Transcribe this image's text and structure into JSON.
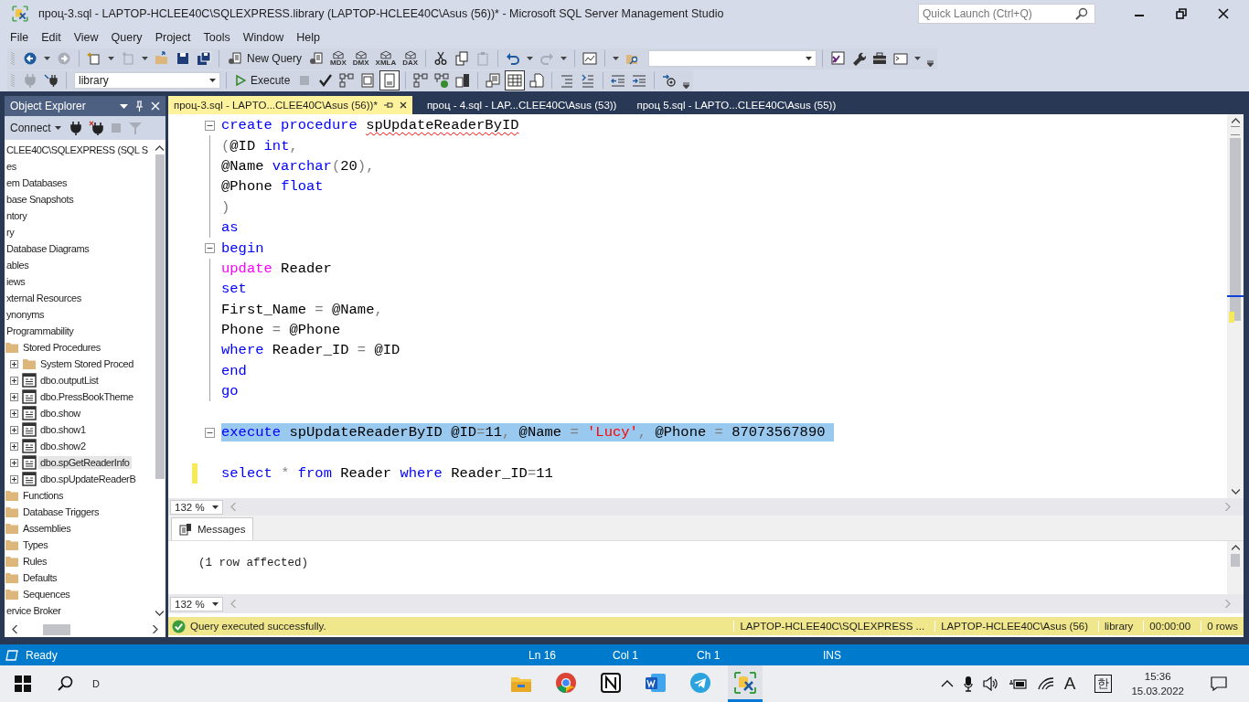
{
  "window": {
    "title": "проц-3.sql - LAPTOP-HCLEE40C\\SQLEXPRESS.library (LAPTOP-HCLEE40C\\Asus (56))* - Microsoft SQL Server Management Studio",
    "quick_launch": {
      "placeholder": "Quick Launch (Ctrl+Q)"
    }
  },
  "menu": [
    "File",
    "Edit",
    "View",
    "Query",
    "Project",
    "Tools",
    "Window",
    "Help"
  ],
  "toolbar": {
    "new_query": "New Query",
    "query_types": [
      "MDX",
      "DMX",
      "XMLA",
      "DAX"
    ],
    "database": "library",
    "execute": "Execute"
  },
  "object_explorer": {
    "title": "Object Explorer",
    "connect": "Connect",
    "tree": [
      {
        "label": "CLEE40C\\SQLEXPRESS (SQL S",
        "children": [
          {
            "label": "es",
            "children": [
              {
                "label": "em Databases"
              },
              {
                "label": "base Snapshots"
              },
              {
                "label": "ntory"
              },
              {
                "label": "ry",
                "children": [
                  {
                    "label": "Database Diagrams"
                  },
                  {
                    "label": "ables"
                  },
                  {
                    "label": "iews"
                  },
                  {
                    "label": "xternal Resources"
                  },
                  {
                    "label": "ynonyms"
                  },
                  {
                    "label": "Programmability",
                    "children": [
                      {
                        "label": "Stored Procedures",
                        "kind": "folder",
                        "children": [
                          {
                            "label": "System Stored Proced",
                            "kind": "folder",
                            "expanded": false,
                            "selected": false
                          },
                          {
                            "label": "dbo.outputList",
                            "kind": "procedure",
                            "expanded": false,
                            "selected": false
                          },
                          {
                            "label": "dbo.PressBookTheme",
                            "kind": "procedure",
                            "expanded": false,
                            "selected": false
                          },
                          {
                            "label": "dbo.show",
                            "kind": "procedure",
                            "expanded": false,
                            "selected": false
                          },
                          {
                            "label": "dbo.show1",
                            "kind": "procedure",
                            "expanded": false,
                            "selected": false
                          },
                          {
                            "label": "dbo.show2",
                            "kind": "procedure",
                            "expanded": false,
                            "selected": false
                          },
                          {
                            "label": "dbo.spGetReaderInfo",
                            "kind": "procedure",
                            "expanded": false,
                            "selected": true
                          },
                          {
                            "label": "dbo.spUpdateReaderB",
                            "kind": "procedure",
                            "expanded": false,
                            "selected": false
                          }
                        ]
                      },
                      {
                        "label": "Functions",
                        "kind": "folder"
                      },
                      {
                        "label": "Database Triggers",
                        "kind": "folder"
                      },
                      {
                        "label": "Assemblies",
                        "kind": "folder"
                      },
                      {
                        "label": "Types",
                        "kind": "folder"
                      },
                      {
                        "label": "Rules",
                        "kind": "folder"
                      },
                      {
                        "label": "Defaults",
                        "kind": "folder"
                      },
                      {
                        "label": "Sequences",
                        "kind": "folder"
                      }
                    ]
                  },
                  {
                    "label": "ervice Broker"
                  }
                ]
              }
            ]
          }
        ]
      }
    ]
  },
  "tabs": [
    {
      "label": "проц-3.sql - LAPTO...CLEE40C\\Asus (56))*",
      "selected": true
    },
    {
      "label": "проц - 4.sql - LAP...CLEE40C\\Asus (53))",
      "selected": false
    },
    {
      "label": "проц 5.sql - LAPTO...CLEE40C\\Asus (55))",
      "selected": false
    }
  ],
  "editor": {
    "zoom": "132 %",
    "lines": [
      {
        "kind": "code",
        "fold": true,
        "selected": false,
        "changed": false,
        "tokens": [
          {
            "text": "create procedure ",
            "kind": "keyword"
          },
          {
            "text": "spUpdateReaderByID",
            "kind": "plain",
            "squiggle": true
          }
        ]
      },
      {
        "kind": "code",
        "fold": false,
        "selected": false,
        "changed": false,
        "tokens": [
          {
            "text": "(",
            "kind": "operator"
          },
          {
            "text": "@ID ",
            "kind": "plain"
          },
          {
            "text": "int",
            "kind": "keyword"
          },
          {
            "text": ",",
            "kind": "operator"
          }
        ]
      },
      {
        "kind": "code",
        "fold": false,
        "selected": false,
        "changed": false,
        "tokens": [
          {
            "text": "@Name ",
            "kind": "plain"
          },
          {
            "text": "varchar",
            "kind": "keyword"
          },
          {
            "text": "(",
            "kind": "operator"
          },
          {
            "text": "20",
            "kind": "plain"
          },
          {
            "text": "),",
            "kind": "operator"
          }
        ]
      },
      {
        "kind": "code",
        "fold": false,
        "selected": false,
        "changed": false,
        "tokens": [
          {
            "text": "@Phone ",
            "kind": "plain"
          },
          {
            "text": "float",
            "kind": "keyword"
          }
        ]
      },
      {
        "kind": "code",
        "fold": false,
        "selected": false,
        "changed": false,
        "tokens": [
          {
            "text": ")",
            "kind": "operator"
          }
        ]
      },
      {
        "kind": "code",
        "fold": false,
        "selected": false,
        "changed": false,
        "tokens": [
          {
            "text": "as",
            "kind": "keyword"
          }
        ]
      },
      {
        "kind": "code",
        "fold": true,
        "selected": false,
        "changed": false,
        "tokens": [
          {
            "text": "begin",
            "kind": "keyword"
          }
        ]
      },
      {
        "kind": "code",
        "fold": false,
        "selected": false,
        "changed": false,
        "tokens": [
          {
            "text": "update",
            "kind": "system"
          },
          {
            "text": " Reader",
            "kind": "plain"
          }
        ]
      },
      {
        "kind": "code",
        "fold": false,
        "selected": false,
        "changed": false,
        "tokens": [
          {
            "text": "set",
            "kind": "keyword"
          }
        ]
      },
      {
        "kind": "code",
        "fold": false,
        "selected": false,
        "changed": false,
        "tokens": [
          {
            "text": "First_Name ",
            "kind": "plain"
          },
          {
            "text": "=",
            "kind": "operator"
          },
          {
            "text": " @Name",
            "kind": "plain"
          },
          {
            "text": ",",
            "kind": "operator"
          }
        ]
      },
      {
        "kind": "code",
        "fold": false,
        "selected": false,
        "changed": false,
        "tokens": [
          {
            "text": "Phone ",
            "kind": "plain"
          },
          {
            "text": "=",
            "kind": "operator"
          },
          {
            "text": " @Phone",
            "kind": "plain"
          }
        ]
      },
      {
        "kind": "code",
        "fold": false,
        "selected": false,
        "changed": false,
        "tokens": [
          {
            "text": "where",
            "kind": "keyword"
          },
          {
            "text": " Reader_ID ",
            "kind": "plain"
          },
          {
            "text": "=",
            "kind": "operator"
          },
          {
            "text": " @ID",
            "kind": "plain"
          }
        ]
      },
      {
        "kind": "code",
        "fold": false,
        "selected": false,
        "changed": false,
        "tokens": [
          {
            "text": "end",
            "kind": "keyword"
          }
        ]
      },
      {
        "kind": "code",
        "fold": false,
        "selected": false,
        "changed": false,
        "tokens": [
          {
            "text": "go",
            "kind": "keyword"
          }
        ]
      },
      {
        "kind": "blank"
      },
      {
        "kind": "code",
        "fold": true,
        "selected": true,
        "changed": false,
        "tokens": [
          {
            "text": "execute",
            "kind": "keyword"
          },
          {
            "text": " spUpdateReaderByID @ID",
            "kind": "plain"
          },
          {
            "text": "=",
            "kind": "operator"
          },
          {
            "text": "11",
            "kind": "plain"
          },
          {
            "text": ",",
            "kind": "operator"
          },
          {
            "text": " @Name ",
            "kind": "plain"
          },
          {
            "text": "= ",
            "kind": "operator"
          },
          {
            "text": "'Lucy'",
            "kind": "string"
          },
          {
            "text": ",",
            "kind": "operator"
          },
          {
            "text": " @Phone ",
            "kind": "plain"
          },
          {
            "text": "=",
            "kind": "operator"
          },
          {
            "text": " 87073567890 ",
            "kind": "plain"
          }
        ]
      },
      {
        "kind": "blank"
      },
      {
        "kind": "code",
        "fold": false,
        "selected": false,
        "changed": true,
        "tokens": [
          {
            "text": "select ",
            "kind": "keyword"
          },
          {
            "text": "* ",
            "kind": "operator"
          },
          {
            "text": "from",
            "kind": "keyword"
          },
          {
            "text": " Reader ",
            "kind": "plain"
          },
          {
            "text": "where",
            "kind": "keyword"
          },
          {
            "text": " Reader_ID",
            "kind": "plain"
          },
          {
            "text": "=",
            "kind": "operator"
          },
          {
            "text": "11",
            "kind": "plain"
          }
        ]
      }
    ]
  },
  "results": {
    "tab": "Messages",
    "messages": [
      "(1 row affected)"
    ],
    "zoom": "132 %"
  },
  "query_status": {
    "message": "Query executed successfully.",
    "server": "LAPTOP-HCLEE40C\\SQLEXPRESS ...",
    "login": "LAPTOP-HCLEE40C\\Asus (56)",
    "database": "library",
    "elapsed": "00:00:00",
    "rows": "0 rows"
  },
  "status_bar": {
    "text": "Ready",
    "line": "Ln 16",
    "column": "Col 1",
    "char": "Ch 1",
    "mode": "INS"
  },
  "taskbar": {
    "search_text": "D",
    "apps": [
      {
        "kind": "explorer",
        "selected": false
      },
      {
        "kind": "chrome",
        "selected": false
      },
      {
        "kind": "notion",
        "selected": false
      },
      {
        "kind": "word",
        "selected": false
      },
      {
        "kind": "telegram",
        "selected": false
      },
      {
        "kind": "ssms",
        "selected": true
      }
    ],
    "tray": {
      "input_language": "A",
      "ime": "한",
      "time": "15:36",
      "date": "15.03.2022"
    }
  }
}
